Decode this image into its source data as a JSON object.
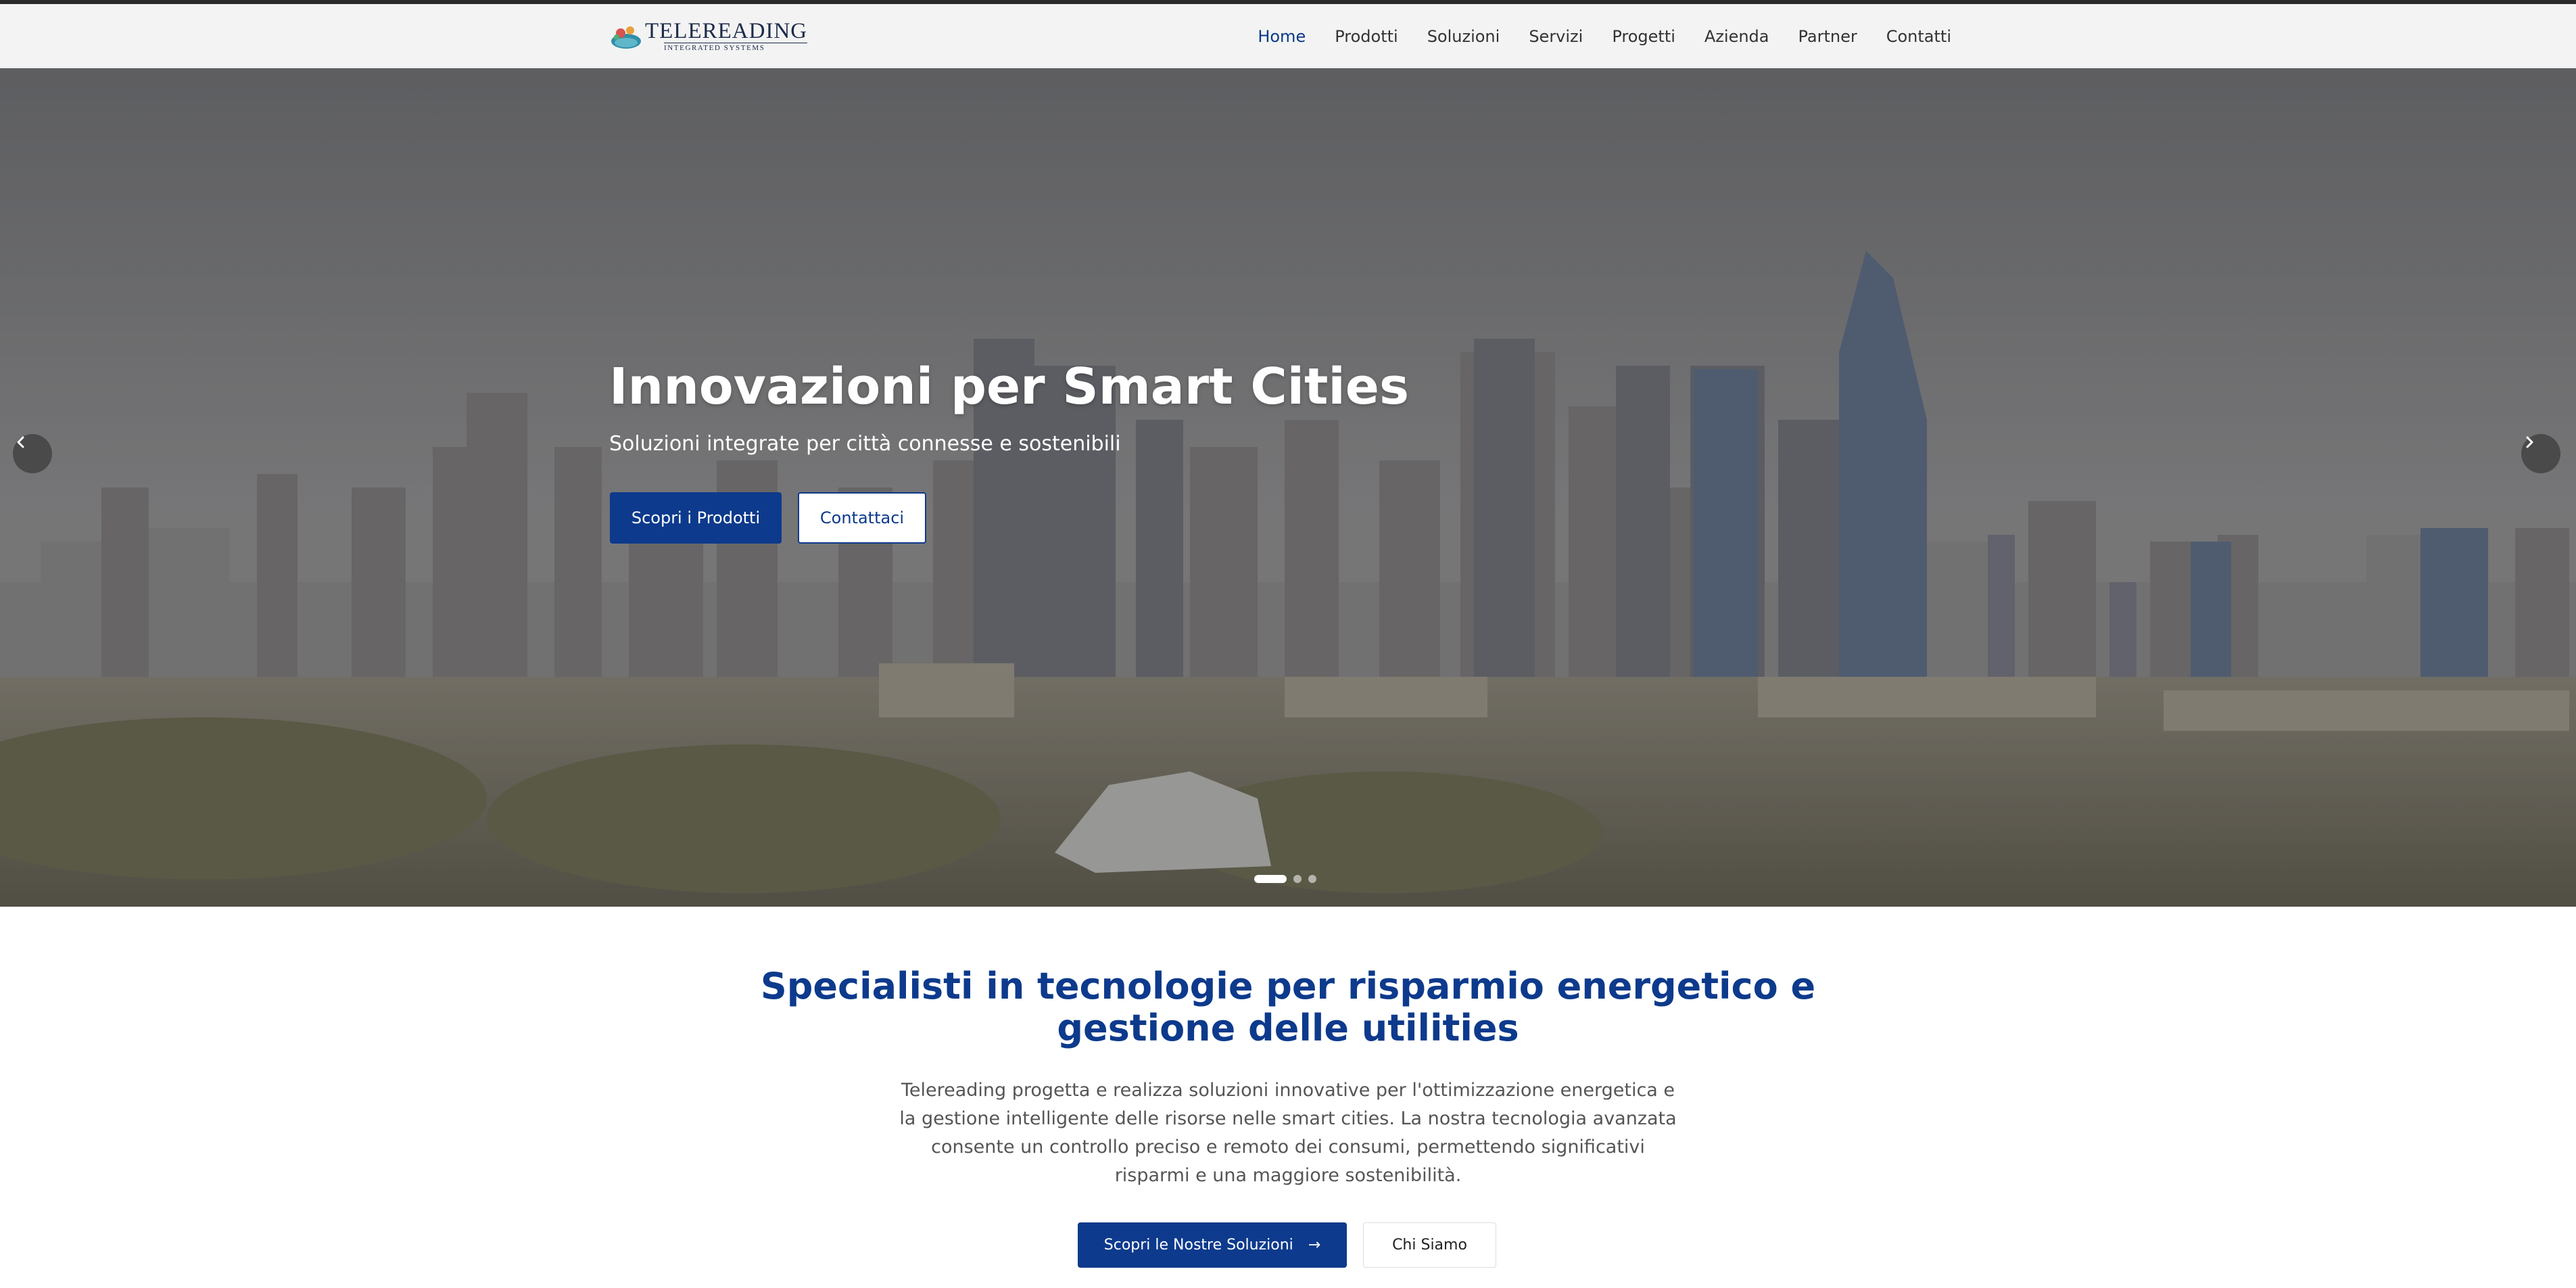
{
  "brand": {
    "name": "TELEREADING",
    "tagline": "INTEGRATED SYSTEMS",
    "logo_icon": "telereading-logo"
  },
  "nav": {
    "items": [
      {
        "label": "Home",
        "active": true
      },
      {
        "label": "Prodotti"
      },
      {
        "label": "Soluzioni"
      },
      {
        "label": "Servizi"
      },
      {
        "label": "Progetti"
      },
      {
        "label": "Azienda"
      },
      {
        "label": "Partner"
      },
      {
        "label": "Contatti"
      }
    ]
  },
  "hero": {
    "title": "Innovazioni per Smart Cities",
    "subtitle": "Soluzioni integrate per città connesse e sostenibili",
    "primary_button": "Scopri i Prodotti",
    "secondary_button": "Contattaci",
    "prev_icon": "chevron-left-icon",
    "next_icon": "chevron-right-icon",
    "slide_count": 3,
    "active_slide": 1
  },
  "intro": {
    "title": "Specialisti in tecnologie per risparmio energetico e gestione delle utilities",
    "text": "Telereading progetta e realizza soluzioni innovative per l'ottimizzazione energetica e la gestione intelligente delle risorse nelle smart cities. La nostra tecnologia avanzata consente un controllo preciso e remoto dei consumi, permettendo significativi risparmi e una maggiore sostenibilità.",
    "primary_button": "Scopri le Nostre Soluzioni",
    "secondary_button": "Chi Siamo",
    "arrow_icon": "arrow-right-icon"
  },
  "colors": {
    "primary": "#0d3a8c",
    "nav_active": "#0a3a87",
    "text": "#555555"
  }
}
